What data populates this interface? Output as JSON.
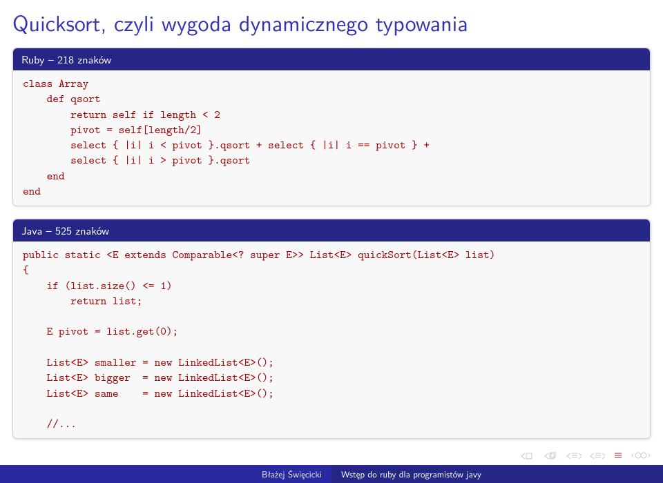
{
  "title": "Quicksort, czyli wygoda dynamicznego typowania",
  "blocks": {
    "ruby": {
      "header": "Ruby – 218 znaków",
      "code": "class Array\n    def qsort\n        return self if length < 2\n        pivot = self[length/2]\n        select { |i| i < pivot }.qsort + select { |i| i == pivot } +\n        select { |i| i > pivot }.qsort\n    end\nend"
    },
    "java": {
      "header": "Java – 525 znaków",
      "code": "public static <E extends Comparable<? super E>> List<E> quickSort(List<E> list)\n{\n    if (list.size() <= 1)\n        return list;\n\n    E pivot = list.get(0);\n\n    List<E> smaller = new LinkedList<E>();\n    List<E> bigger  = new LinkedList<E>();\n    List<E> same    = new LinkedList<E>();\n\n    //..."
    }
  },
  "footer": {
    "author": "Błażej Święcicki",
    "talk": "Wstęp do ruby dla programistów javy"
  }
}
